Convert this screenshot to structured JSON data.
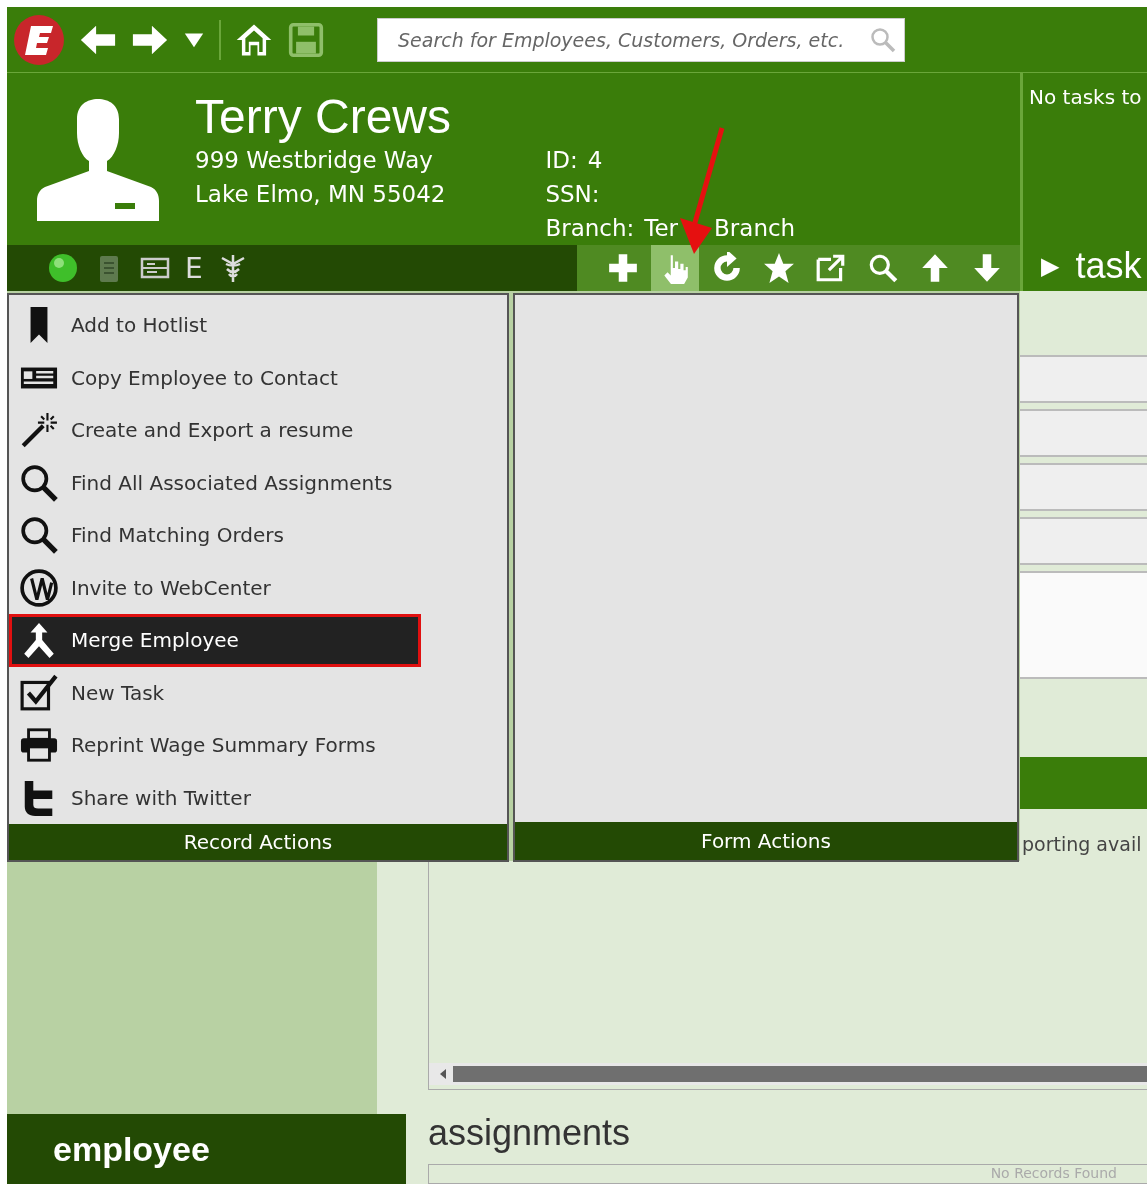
{
  "app_bar": {
    "search": {
      "placeholder": "Search for Employees, Customers, Orders, etc."
    }
  },
  "record": {
    "name": "Terry Crews",
    "address_line_1": "999 Westbridge Way",
    "address_line_2": "Lake Elmo, MN 55042",
    "id_label": "ID:",
    "id": "4",
    "ssn_label": "SSN:",
    "branch_label": "Branch:",
    "branch_start": "Ter",
    "branch_end": "Branch"
  },
  "tasks": {
    "message": "No tasks to",
    "toggle": "▶",
    "label": "task"
  },
  "status_letter": "E",
  "toolbar_buttons": [
    {
      "selected": false
    },
    {
      "selected": true
    },
    {
      "selected": false
    },
    {
      "selected": false
    },
    {
      "selected": false
    },
    {
      "selected": false
    },
    {
      "selected": false
    },
    {
      "selected": false
    }
  ],
  "record_actions": {
    "title": "Record Actions",
    "items": [
      {
        "label": "Add to Hotlist",
        "selected": false
      },
      {
        "label": "Copy Employee to Contact",
        "selected": false
      },
      {
        "label": "Create and Export a resume",
        "selected": false
      },
      {
        "label": "Find All Associated Assignments",
        "selected": false
      },
      {
        "label": "Find Matching Orders",
        "selected": false
      },
      {
        "label": "Invite to WebCenter",
        "selected": false
      },
      {
        "label": "Merge Employee",
        "selected": true
      },
      {
        "label": "New Task",
        "selected": false
      },
      {
        "label": "Reprint Wage Summary Forms",
        "selected": false
      },
      {
        "label": "Share with Twitter",
        "selected": false
      }
    ]
  },
  "form_actions": {
    "title": "Form Actions"
  },
  "reporting_text": "porting avail",
  "sidebar": {
    "section": "employee"
  },
  "assignments": {
    "title": "assignments",
    "empty": "No Records Found"
  }
}
